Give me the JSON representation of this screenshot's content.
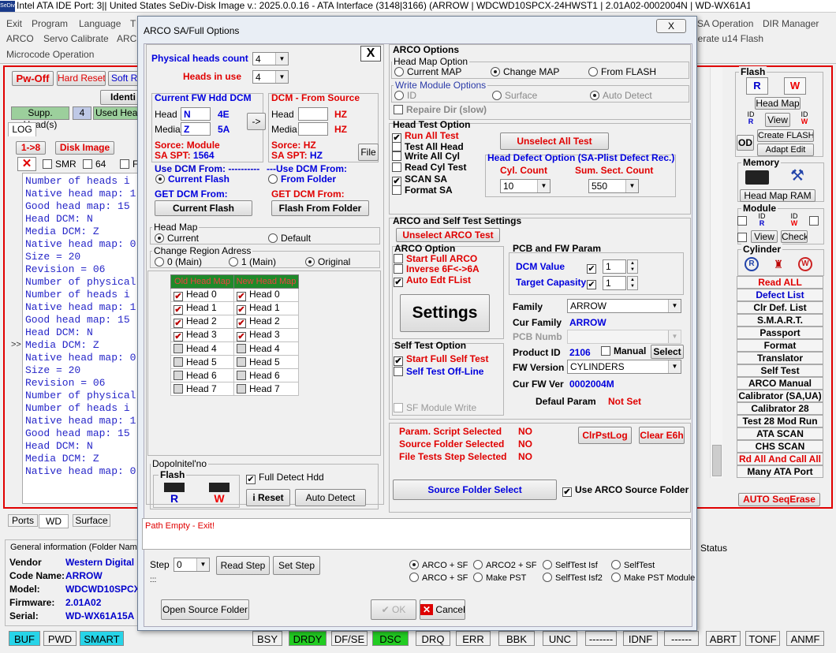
{
  "title": "Intel ATA IDE  Port: 3|| United States  SeDiv-Disk Image v.: 2025.0.0.16 - ATA Interface (3148|3166) (ARROW | WDCWD10SPCX-24HWST1 | 2.01A02-0002004N | WD-WX61A1...",
  "app_icon": "SeDiv",
  "menu": {
    "row1": [
      "Exit",
      "Program",
      "Language",
      "T"
    ],
    "row2": [
      "ARCO",
      "Servo Calibrate",
      "ARCO"
    ],
    "row3": "Microcode Operation",
    "right1": "SA Operation",
    "right2": "DIR Manager",
    "right3": "nerate u14 Flash"
  },
  "bg": {
    "pw_off": "Pw-Off",
    "hard_reset": "Hard Reset",
    "soft_reset": "Soft Re",
    "identify": "Identi",
    "supp_heads": "Supp. Head(s)",
    "supp_count": "4",
    "used_heads": "Used Head",
    "log_tab": "LOG",
    "r18": "1->8",
    "disk_image": "Disk Image",
    "smr": "SMR",
    "n64": "64",
    "f": "F",
    "expand": ">>"
  },
  "log_lines": [
    "Number of heads i",
    "Native head map: 1",
    "Good head map: 15",
    "Head DCM: N",
    "Media DCM: Z",
    "Native head map: 0",
    "Size = 20",
    "Revision = 06",
    "Number of physical",
    "Number of heads i",
    "Native head map: 1",
    "Good head map: 15",
    "Head DCM: N",
    "Media DCM: Z",
    "Native head map: 0",
    "Size = 20",
    "Revision = 06",
    "Number of physical",
    "Number of heads i",
    "Native head map: 1",
    "Good head map: 15",
    "Head DCM: N",
    "Media DCM: Z",
    "Native head map: 0"
  ],
  "bottom_tabs": [
    "Ports",
    "WD",
    "Surface"
  ],
  "general": {
    "title": "General information (Folder Name",
    "rows": [
      {
        "k": "Vendor",
        "v": "Western Digital"
      },
      {
        "k": "Code Name:",
        "v": "ARROW"
      },
      {
        "k": "Model:",
        "v": "WDCWD10SPCX"
      },
      {
        "k": "Firmware:",
        "v": "2.01A02"
      },
      {
        "k": "Serial:",
        "v": "WD-WX61A15A"
      }
    ],
    "status": "Status"
  },
  "status_bar": [
    {
      "t": "BUF",
      "bg": "#27d4e8"
    },
    {
      "t": "PWD",
      "bg": "#f0f0f0"
    },
    {
      "t": "SMART",
      "bg": "#27d4e8"
    },
    {
      "t": "BSY",
      "bg": "#f0f0f0"
    },
    {
      "t": "DRDY",
      "bg": "#22cc22"
    },
    {
      "t": "DF/SE",
      "bg": "#f0f0f0"
    },
    {
      "t": "DSC",
      "bg": "#22cc22"
    },
    {
      "t": "DRQ",
      "bg": "#f0f0f0"
    },
    {
      "t": "ERR",
      "bg": "#f0f0f0"
    },
    {
      "t": "BBK",
      "bg": "#f0f0f0"
    },
    {
      "t": "UNC",
      "bg": "#f0f0f0"
    },
    {
      "t": "-------",
      "bg": "#f0f0f0"
    },
    {
      "t": "IDNF",
      "bg": "#f0f0f0"
    },
    {
      "t": "------",
      "bg": "#f0f0f0"
    },
    {
      "t": "ABRT",
      "bg": "#f0f0f0"
    },
    {
      "t": "TONF",
      "bg": "#f0f0f0"
    },
    {
      "t": "ANMF",
      "bg": "#f0f0f0"
    }
  ],
  "right_panel": {
    "flash": "Flash",
    "head_map": "Head Map",
    "id": "ID",
    "view": "View",
    "id2": "ID",
    "create_flash": "Create FLASH",
    "od": "OD",
    "adapt_edit": "Adapt Edit",
    "memory": "Memory",
    "head_map_ram": "Head Map RAM",
    "module": "Module",
    "view2": "View",
    "check": "Check",
    "cylinder": "Cylinder",
    "buttons": [
      {
        "t": "Read ALL",
        "red": true
      },
      {
        "t": "Defect List",
        "blue": true
      },
      {
        "t": "Clr Def. List"
      },
      {
        "t": "S.M.A.R.T."
      },
      {
        "t": "Passport"
      },
      {
        "t": "Format"
      },
      {
        "t": "Translator"
      },
      {
        "t": "Self Test"
      },
      {
        "t": "ARCO Manual"
      },
      {
        "t": "Calibrator (SA,UA)"
      },
      {
        "t": "Calibrator 28"
      },
      {
        "t": "Test 28 Mod Run"
      },
      {
        "t": "ATA SCAN"
      },
      {
        "t": "CHS SCAN"
      },
      {
        "t": "Rd All And Call All",
        "red": true
      },
      {
        "t": "Many ATA Port"
      }
    ],
    "auto_seq": "AUTO SeqErase"
  },
  "dialog": {
    "title": "ARCO SA/Full Options",
    "close": "X",
    "phys_heads_label": "Physical heads count",
    "phys_heads": "4",
    "heads_in_use_label": "Heads in use",
    "heads_in_use": "4",
    "x_btn": "X",
    "cur_fw": {
      "title": "Current FW Hdd DCM",
      "head_label": "Head",
      "head_val": "N",
      "head_hex": "4E",
      "media_label": "Media",
      "media_val": "Z",
      "media_hex": "5A",
      "source_label": "Sorce:",
      "source_val": "Module",
      "spt_label": "SA SPT:",
      "spt_val": "1564"
    },
    "arrow_btn": "->",
    "dcm_src": {
      "title": "DCM - From Source",
      "head_label": "Head",
      "head_hex": "HZ",
      "media_label": "Media",
      "media_hex": "HZ",
      "source_label": "Sorce:",
      "source_val": "HZ",
      "spt_label": "SA SPT:",
      "spt_val": "HZ",
      "file_btn": "File"
    },
    "use_dcm1": {
      "title": "Use DCM From: ----------",
      "opt": "Current Flash"
    },
    "use_dcm2": {
      "title": "---Use DCM From:",
      "opt": "From Folder"
    },
    "get_dcm1": {
      "title": "GET DCM From:",
      "btn": "Current Flash"
    },
    "get_dcm2": {
      "title": "GET DCM From:",
      "btn": "Flash From Folder"
    },
    "head_map_grp": {
      "title": "Head Map",
      "opt1": "Current",
      "opt2": "Default"
    },
    "change_region": {
      "title": "Change Region Adress",
      "opt1": "0 (Main)",
      "opt2": "1 (Main)",
      "opt3": "Original"
    },
    "old_map_header": "Old Head Map",
    "new_map_header": "New Head Map",
    "heads": [
      {
        "n": "Head 0",
        "old": true,
        "new": true
      },
      {
        "n": "Head 1",
        "old": true,
        "new": true
      },
      {
        "n": "Head 2",
        "old": true,
        "new": true
      },
      {
        "n": "Head 3",
        "old": true,
        "new": true
      },
      {
        "n": "Head 4",
        "old": false,
        "new": false
      },
      {
        "n": "Head 5",
        "old": false,
        "new": false
      },
      {
        "n": "Head 6",
        "old": false,
        "new": false
      },
      {
        "n": "Head 7",
        "old": false,
        "new": false
      }
    ],
    "dopolnitelno": "Dopolnitel'no",
    "flash_lbl": "Flash",
    "full_detect": "Full Detect Hdd",
    "i_reset": "i Reset",
    "auto_detect": "Auto Detect",
    "arco_options": {
      "title": "ARCO Options",
      "head_map_opt": "Head Map Option",
      "current_map": "Current MAP",
      "change_map": "Change MAP",
      "from_flash": "From FLASH",
      "write_module": "Write Module Options",
      "id": "ID",
      "surface": "Surface",
      "auto_detect": "Auto Detect",
      "repaire_dir": "Repaire Dir (slow)"
    },
    "head_test": {
      "title": "Head Test Option",
      "run_all": "Run All Test",
      "test_all_head": "Test All Head",
      "write_all_cyl": "Write All Cyl",
      "read_cyl": "Read Cyl Test",
      "scan_sa": "SCAN SA",
      "format_sa": "Format SA",
      "unselect_all": "Unselect All Test",
      "head_defect": "Head Defect Option (SA-Plist Defect Rec.)",
      "cyl_count_label": "Cyl. Count",
      "cyl_count": "10",
      "sum_sect_label": "Sum. Sect. Count",
      "sum_sect": "550"
    },
    "arco_self": {
      "title": "ARCO and Self Test Settings",
      "unselect_arco": "Unselect ARCO Test",
      "arco_option": "ARCO Option",
      "start_full": "Start Full ARCO",
      "inverse": "Inverse 6F<->6A",
      "auto_edt": "Auto Edt FList",
      "settings": "Settings",
      "pcb_fw": "PCB and FW Param",
      "dcm_value": "DCM Value",
      "dcm_num": "1",
      "target_cap": "Target Capasity",
      "target_num": "1",
      "family_label": "Family",
      "family": "ARROW",
      "cur_family_label": "Cur Family",
      "cur_family": "ARROW",
      "pcb_numb": "PCB Numb",
      "product_id_label": "Product ID",
      "product_id": "2106",
      "manual": "Manual",
      "select": "Select",
      "fw_version_label": "FW Version",
      "fw_version": "CYLINDERS",
      "cur_fw_ver_label": "Cur FW Ver",
      "cur_fw_ver": "0002004M",
      "defaul_param": "Defaul Param",
      "not_set": "Not Set"
    },
    "self_test": {
      "title": "Self Test Option",
      "start_full": "Start Full Self Test",
      "self_off": "Self Test Off-Line",
      "sf_module": "SF Module Write"
    },
    "params": [
      {
        "k": "Param. Script Selected",
        "v": "NO"
      },
      {
        "k": "Source Folder Selected",
        "v": "NO"
      },
      {
        "k": "File Tests Step Selected",
        "v": "NO"
      }
    ],
    "clr_pst": "ClrPstLog",
    "clear_e6h": "Clear E6h",
    "source_folder": "Source Folder Select",
    "use_arco_src": "Use ARCO Source Folder",
    "path_msg": "Path Empty - Exit!",
    "step_label": "Step",
    "step_val": "0",
    "read_step": "Read Step",
    "set_step": "Set Step",
    "radios_row1": [
      "ARCO + SF",
      "ARCO2 + SF",
      "SelfTest Isf",
      "SelfTest"
    ],
    "radios_row2": [
      "ARCO + SF",
      "Make PST",
      "SelfTest Isf2",
      "Make PST Module"
    ],
    "dots": ":::",
    "open_src": "Open Source Folder",
    "ok": "OK",
    "cancel": "Cancel"
  }
}
